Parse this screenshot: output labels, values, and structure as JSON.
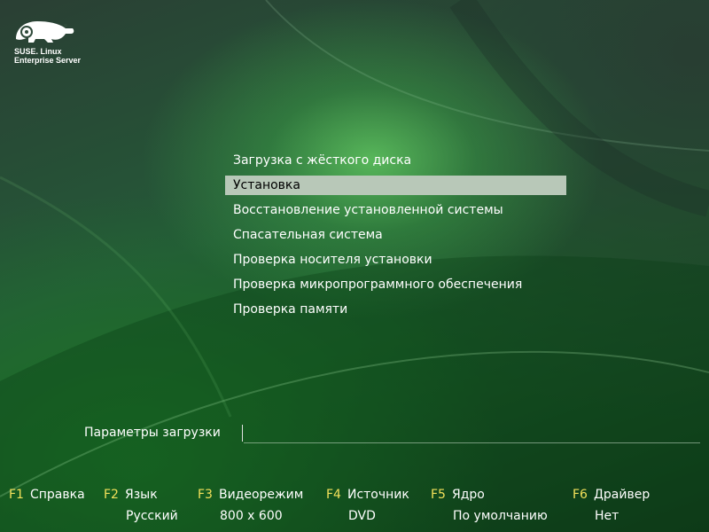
{
  "logo": {
    "text": "SUSE. Linux\nEnterprise Server"
  },
  "menu": {
    "items": [
      {
        "label": "Загрузка с жёсткого диска"
      },
      {
        "label": "Установка"
      },
      {
        "label": "Восстановление установленной системы"
      },
      {
        "label": "Спасательная система"
      },
      {
        "label": "Проверка носителя установки"
      },
      {
        "label": "Проверка микропрограммного обеспечения"
      },
      {
        "label": "Проверка памяти"
      }
    ],
    "selected_index": 1
  },
  "boot_options": {
    "label": "Параметры загрузки",
    "value": ""
  },
  "fkeys": [
    {
      "key": "F1",
      "name": "Справка",
      "value": ""
    },
    {
      "key": "F2",
      "name": "Язык",
      "value": "Русский"
    },
    {
      "key": "F3",
      "name": "Видеорежим",
      "value": "800 x 600"
    },
    {
      "key": "F4",
      "name": "Источник",
      "value": "DVD"
    },
    {
      "key": "F5",
      "name": "Ядро",
      "value": "По умолчанию"
    },
    {
      "key": "F6",
      "name": "Драйвер",
      "value": "Нет"
    }
  ],
  "colors": {
    "accent_key": "#f2e05a",
    "selected_bg": "#b8c8b8",
    "background": "#245a38"
  }
}
